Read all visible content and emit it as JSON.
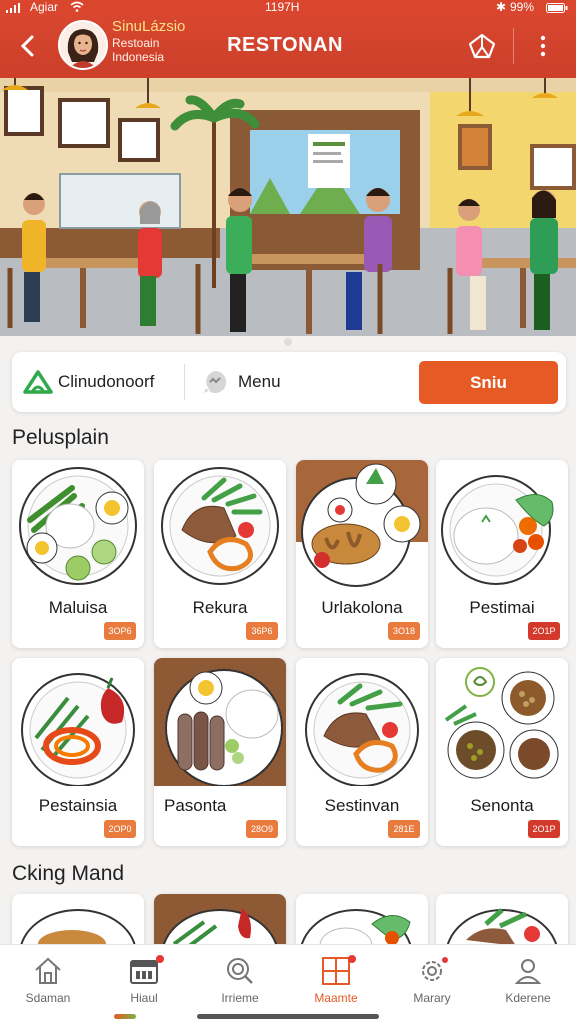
{
  "status_bar": {
    "carrier": "Agiar",
    "time": "1197H",
    "battery": "99%"
  },
  "header": {
    "brand_name": "SinuLázsio",
    "brand_sub1": "Restoain",
    "brand_sub2": "Indonesia",
    "title": "RESTONAN",
    "back_icon": "chevron-left-icon",
    "share_icon": "share-icon",
    "more_icon": "more-vertical-icon"
  },
  "action_bar": {
    "location_label": "Clinudonoorf",
    "menu_label": "Menu",
    "cta_label": "Sniu",
    "accent_color": "#e55a25"
  },
  "sections": [
    {
      "title": "Pelusplain",
      "cards": [
        {
          "name": "Maluisa",
          "price": "3OP6"
        },
        {
          "name": "Rekura",
          "price": "36P6"
        },
        {
          "name": "Urlakolona",
          "price": "3O18"
        },
        {
          "name": "Pestimai",
          "price": "2O1P"
        },
        {
          "name": "Pestainsia",
          "price": "2OP0"
        },
        {
          "name": "Pasonta",
          "price": "28O9"
        },
        {
          "name": "Sestinvan",
          "price": "281E"
        },
        {
          "name": "Senonta",
          "price": "2O1P"
        }
      ]
    },
    {
      "title": "Cking Mand"
    }
  ],
  "bottom_nav": [
    {
      "label": "Sdaman",
      "icon": "home-icon"
    },
    {
      "label": "Hiaul",
      "icon": "calendar-icon"
    },
    {
      "label": "Irrieme",
      "icon": "search-icon"
    },
    {
      "label": "Maamte",
      "icon": "grid-icon",
      "active": true
    },
    {
      "label": "Marary",
      "icon": "gear-icon"
    },
    {
      "label": "Kderene",
      "icon": "user-icon"
    }
  ]
}
